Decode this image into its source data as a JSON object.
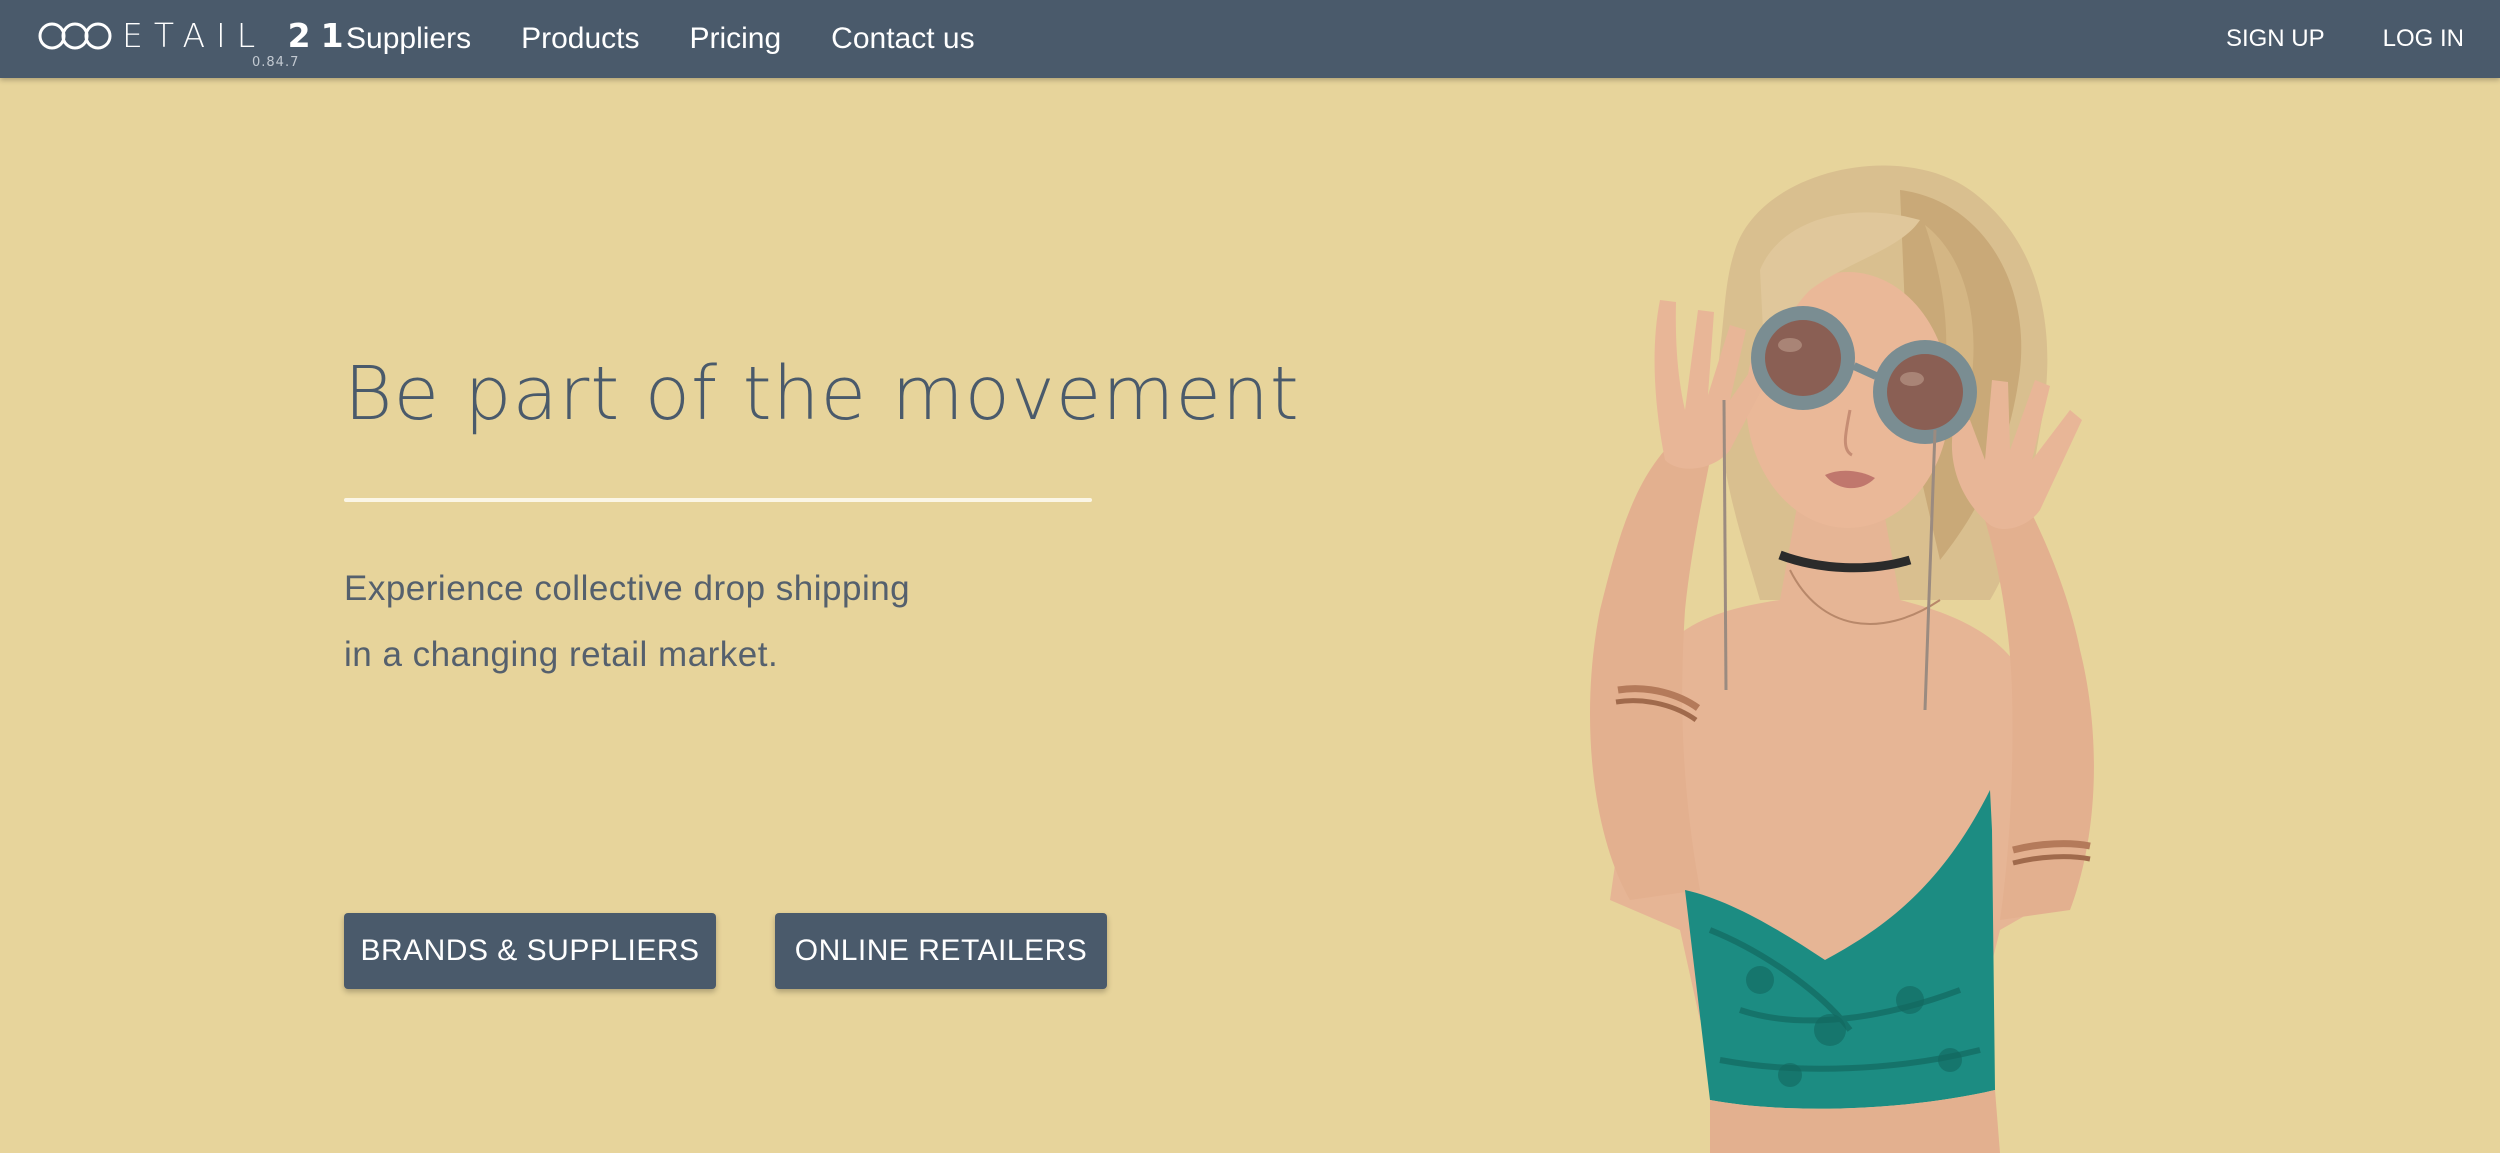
{
  "navbar": {
    "logo": {
      "text_light": "ETAIL",
      "text_bold": "21",
      "version": "0.84.7"
    },
    "links": [
      {
        "label": "Suppliers"
      },
      {
        "label": "Products"
      },
      {
        "label": "Pricing"
      },
      {
        "label": "Contact us"
      }
    ],
    "actions": {
      "sign_up": "SIGN UP",
      "log_in": "LOG IN"
    }
  },
  "hero": {
    "title": "Be part of the movement",
    "subtitle_line1": "Experience collective drop shipping",
    "subtitle_line2": "in a changing retail market.",
    "buttons": {
      "suppliers": "BRANDS & SUPPLIERS",
      "retailers": "ONLINE RETAILERS"
    },
    "image": {
      "icon": "hero-person-photo"
    }
  },
  "colors": {
    "navbar_bg": "#4a5a6b",
    "page_bg": "#e7d49b",
    "heading_text": "#4a5a6b",
    "button_bg": "#4a5a6b",
    "divider": "#fbf6e6"
  }
}
